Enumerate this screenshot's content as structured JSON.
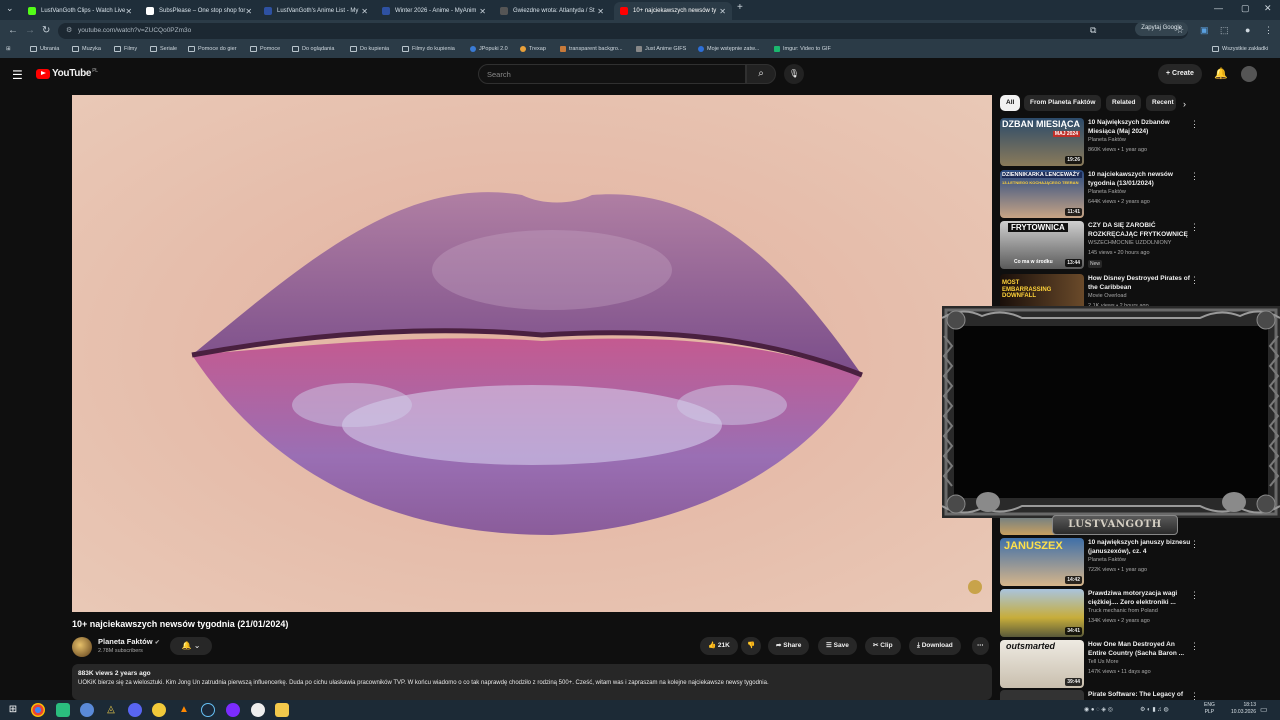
{
  "browser": {
    "tabs": [
      {
        "title": "LustVanGoth Clips - Watch Live",
        "color": "#53fc18"
      },
      {
        "title": "SubsPlease – One stop shop for",
        "color": "#ffffff"
      },
      {
        "title": "LustVanGoth's Anime List - My",
        "color": "#2e51a2"
      },
      {
        "title": "Winter 2026 - Anime - MyAnim",
        "color": "#2e51a2"
      },
      {
        "title": "Gwiezdne wrota: Atlantyda / St",
        "color": "#333333"
      },
      {
        "title": "10+ najciekawszych newsów ty",
        "color": "#ff0000"
      }
    ],
    "url": "youtube.com/watch?v=ZUCQo0PZm3o",
    "ask_google": "Zapytaj Google",
    "bookmarks": [
      "Ubrania",
      "Muzyka",
      "Filmy",
      "Seriale",
      "Pomoce do gier",
      "Pomoce",
      "Do oglądania",
      "Do kupienia",
      "Filmy do kupienia",
      "JPopuki 2.0",
      "Trexap",
      "transparent backgro...",
      "Just Anime GIFS",
      "Moje wstępnie zatw...",
      "Imgur: Video to GIF"
    ],
    "all_bookmarks": "Wszystkie zakładki"
  },
  "youtube": {
    "logo_text": "YouTube",
    "country": "PL",
    "search_placeholder": "Search",
    "create_label": "Create"
  },
  "video": {
    "title": "10+ najciekawszych newsów tygodnia (21/01/2024)",
    "channel": "Planeta Faktów",
    "subscribers": "2.78M subscribers",
    "likes": "21K",
    "share": "Share",
    "save": "Save",
    "clip": "Clip",
    "download": "Download",
    "stats": "883K views  2 years ago",
    "description": "UOKiK bierze się za wielosztuki. Kim Jong Un zatrudnia pierwszą influencerkę. Duda po cichu ułaskawia pracowników TVP. W końcu wiadomo o co tak naprawdę chodziło z rodziną 500+. Cześć, witam was i zapraszam na kolejne najciekawsze newsy tygodnia."
  },
  "sidebar": {
    "chips": [
      "All",
      "From Planeta Faktów",
      "Related",
      "Recent"
    ],
    "videos": [
      {
        "title": "10 Największych Dzbanów Miesiąca (Maj 2024)",
        "channel": "Planeta Faktów",
        "meta": "860K views • 1 year ago",
        "duration": "19:26",
        "thumb_text": "DZBAN MIESIĄCA",
        "thumb_sub": "MAJ 2024",
        "thumb_color": "#3a5a7a"
      },
      {
        "title": "10 najciekawszych newsów tygodnia (13/01/2024)",
        "channel": "Planeta Faktów",
        "meta": "644K views • 2 years ago",
        "duration": "11:41",
        "thumb_text": "DZIENNIKARKA LENCEWAŻY",
        "thumb_sub": "13-LETNIEGO KOCHAJĄCEGO TEERAN",
        "thumb_color": "#2e4a7e"
      },
      {
        "title": "CZY DA SIĘ ZAROBIĆ ROZKRĘCAJĄC FRYTKOWNICĘ",
        "channel": "WSZECHMOCNIE UZDOLNIONY",
        "meta": "145 views • 20 hours ago",
        "duration": "13:44",
        "thumb_text": "FRYTOWNICA",
        "thumb_sub": "Co ma w środku",
        "thumb_color": "#6b6b6b",
        "badge": "New"
      },
      {
        "title": "How Disney Destroyed Pirates of the Caribbean",
        "channel": "Movie Overload",
        "meta": "2.1K views • 2 hours ago",
        "duration": "",
        "thumb_text": "MOST EMBARRASSING DOWNFALL",
        "thumb_sub": "IN EXISTENCE",
        "thumb_color": "#2a1a12"
      },
      {
        "title": "10 największych januszy biznesu (januszexów), cz. 4",
        "channel": "Planeta Faktów",
        "meta": "722K views • 1 year ago",
        "duration": "14:42",
        "thumb_text": "JANUSZEX",
        "thumb_sub": "",
        "thumb_color": "#3f6fa8"
      },
      {
        "title": "Prawdziwa motoryzacja wagi ciężkiej.... Zero elektroniki ...",
        "channel": "Truck mechanic from Poland",
        "meta": "134K views • 2 years ago",
        "duration": "34:41",
        "thumb_text": "",
        "thumb_sub": "",
        "thumb_color": "#b8a14a"
      },
      {
        "title": "How One Man Destroyed An Entire Country (Sacha Baron ...",
        "channel": "Tell Us More",
        "meta": "147K views • 11 days ago",
        "duration": "39:44",
        "thumb_text": "outsmarted",
        "thumb_sub": "",
        "thumb_color": "#d8d2c8"
      },
      {
        "title": "Pirate Software: The Legacy of",
        "channel": "",
        "meta": "",
        "duration": "",
        "thumb_text": "",
        "thumb_sub": "",
        "thumb_color": "#333333"
      }
    ]
  },
  "overlay": {
    "streamer_name": "LUSTVANGOTH"
  },
  "taskbar": {
    "lang_top": "ENG",
    "lang_bottom": "PLP",
    "time": "18:13",
    "date": "10.03.2026"
  }
}
